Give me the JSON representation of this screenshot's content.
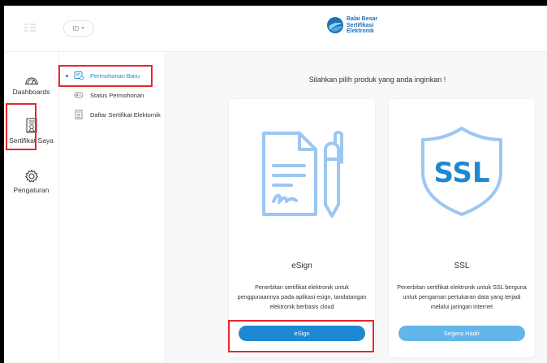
{
  "header": {
    "language": "ID",
    "brand_lines": [
      "Balai Besar",
      "Sertifikasi",
      "Elektronik"
    ]
  },
  "rail": {
    "items": [
      {
        "label": "Dashboards",
        "icon": "gauge-icon"
      },
      {
        "label": "Sertifikat Saya",
        "icon": "certificate-icon"
      },
      {
        "label": "Pengaturan",
        "icon": "gear-icon"
      }
    ]
  },
  "submenu": {
    "items": [
      {
        "label": "Permohonan Baru",
        "icon": "new-request-icon",
        "active": true
      },
      {
        "label": "Status Permohonan",
        "icon": "status-icon"
      },
      {
        "label": "Daftar Sertifikat Elektornik",
        "icon": "certificate-list-icon"
      }
    ]
  },
  "main": {
    "heading": "Silahkan pilih produk yang anda inginkan !",
    "cards": [
      {
        "title": "eSign",
        "description": "Penerbitan sertifikat elektronik untuk penggunaannya pada aplikasi esign, tandatangan elektronik berbasis cloud",
        "button": "eSign"
      },
      {
        "title": "SSL",
        "icon_text": "SSL",
        "description": "Penerbitan sertifikat elektronik untuk SSL berguna untuk pengaman pertukaran data yang terjadi melalui jaringan internet",
        "button": "Segera Hadir"
      }
    ]
  },
  "colors": {
    "accent": "#1e88d2",
    "accent_disabled": "#63b6e9",
    "illustration": "#9cc7f2",
    "highlight": "#e8262b"
  }
}
